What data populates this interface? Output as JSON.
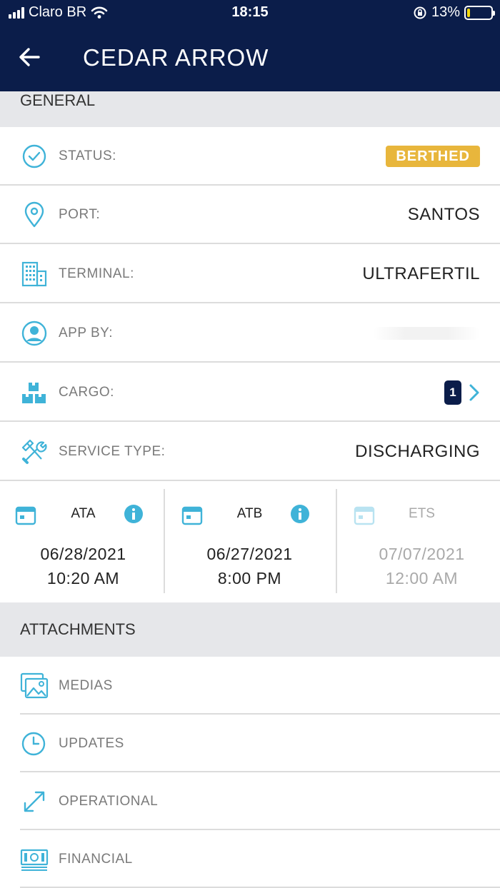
{
  "status_bar": {
    "carrier": "Claro BR",
    "time": "18:15",
    "battery": "13%",
    "battery_level": 0.13
  },
  "nav": {
    "title": "CEDAR ARROW"
  },
  "general": {
    "section_title": "GENERAL",
    "status_label": "STATUS:",
    "status_value": "BERTHED",
    "port_label": "PORT:",
    "port_value": "SANTOS",
    "terminal_label": "TERMINAL:",
    "terminal_value": "ULTRAFERTIL",
    "app_by_label": "APP BY:",
    "cargo_label": "CARGO:",
    "cargo_count": "1",
    "service_label": "SERVICE TYPE:",
    "service_value": "DISCHARGING"
  },
  "dates": [
    {
      "label": "ATA",
      "date": "06/28/2021",
      "time": "10:20 AM"
    },
    {
      "label": "ATB",
      "date": "06/27/2021",
      "time": "8:00 PM"
    },
    {
      "label": "ETS",
      "date": "07/07/2021",
      "time": "12:00 AM"
    }
  ],
  "attachments": {
    "section_title": "ATTACHMENTS",
    "items": [
      "MEDIAS",
      "UPDATES",
      "OPERATIONAL",
      "FINANCIAL"
    ]
  },
  "colors": {
    "header_bg": "#0b1d4a",
    "accent": "#3fb3d8",
    "badge": "#e8b63c"
  }
}
